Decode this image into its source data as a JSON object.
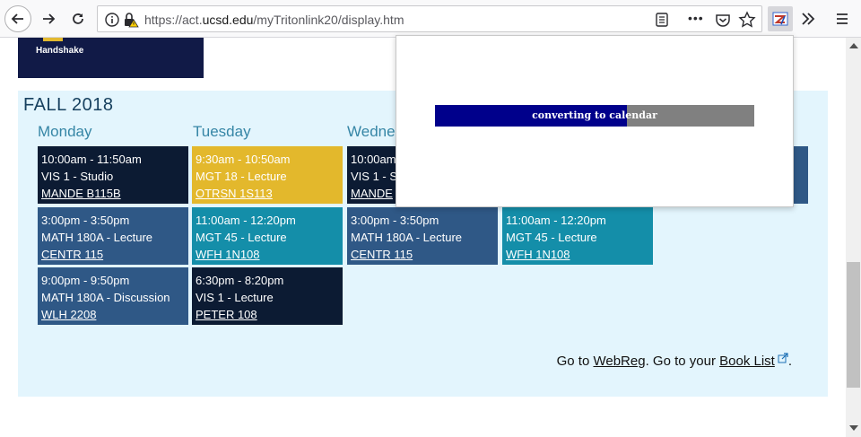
{
  "browser": {
    "url_prefix": "https://act.",
    "url_domain": "ucsd.edu",
    "url_path": "/myTritonlink20/display.htm",
    "more_label": "•••",
    "icons": [
      "back-icon",
      "forward-icon",
      "reload-icon",
      "info-icon",
      "insecure-lock-icon",
      "reader-view-icon",
      "pocket-icon",
      "bookmark-star-icon",
      "calendar-extension-icon",
      "overflow-icon",
      "hamburger-menu-icon"
    ]
  },
  "banner": {
    "label": "Handshake",
    "color": "#111a47"
  },
  "term": {
    "title": "FALL 2018"
  },
  "days": [
    "Monday",
    "Tuesday",
    "Wedne"
  ],
  "colors": {
    "dark": "#0c1b33",
    "gold": "#e3b82c",
    "blue": "#2f5886",
    "teal": "#148ea9",
    "panel": "#e3f5fd",
    "day_heading": "#3686a6"
  },
  "schedule": {
    "mon1": {
      "time": "10:00am - 11:50am",
      "course": "VIS 1 - Studio",
      "location": "MANDE B115B"
    },
    "mon2": {
      "time": "3:00pm - 3:50pm",
      "course": "MATH 180A - Lecture",
      "location": "CENTR 115"
    },
    "mon3": {
      "time": "9:00pm - 9:50pm",
      "course": "MATH 180A - Discussion",
      "location": "WLH 2208"
    },
    "tue1": {
      "time": "9:30am - 10:50am",
      "course": "MGT 18 - Lecture",
      "location": "OTRSN 1S113"
    },
    "tue2": {
      "time": "11:00am - 12:20pm",
      "course": "MGT 45 - Lecture",
      "location": "WFH 1N108"
    },
    "tue3": {
      "time": "6:30pm - 8:20pm",
      "course": "VIS 1 - Lecture",
      "location": "PETER 108"
    },
    "wed1": {
      "time": "10:00am",
      "course": "VIS 1 - S",
      "location": "MANDE"
    },
    "wed2": {
      "time": "3:00pm - 3:50pm",
      "course": "MATH 180A - Lecture",
      "location": "CENTR 115"
    },
    "thu2": {
      "time": "11:00am - 12:20pm",
      "course": "MGT 45 - Lecture",
      "location": "WFH 1N108"
    }
  },
  "footer_links": {
    "go_to_1": "Go to ",
    "webreg": "WebReg",
    "go_to_2": ". Go to your ",
    "book_list": "Book List",
    "end": "."
  },
  "popup": {
    "progress_label": "converting to calendar",
    "progress_fraction": 0.6,
    "bar_color": "#00008b",
    "track_color": "#808080"
  }
}
